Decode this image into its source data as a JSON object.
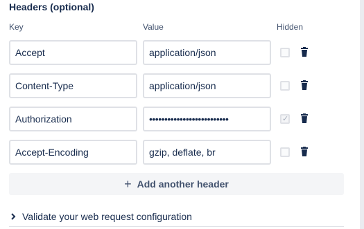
{
  "section_title": "Headers (optional)",
  "columns": {
    "key": "Key",
    "value": "Value",
    "hidden": "Hidden"
  },
  "headers": [
    {
      "key": "Accept",
      "value": "application/json",
      "hidden": false
    },
    {
      "key": "Content-Type",
      "value": "application/json",
      "hidden": false
    },
    {
      "key": "Authorization",
      "value": "••••••••••••••••••••••••••",
      "hidden": true
    },
    {
      "key": "Accept-Encoding",
      "value": "gzip, deflate, br",
      "hidden": false
    }
  ],
  "add_button": {
    "icon": "plus-icon",
    "label": "Add another header"
  },
  "validate": {
    "icon": "chevron-right-icon",
    "label": "Validate your web request configuration"
  },
  "icons": {
    "delete": "trash-icon"
  }
}
